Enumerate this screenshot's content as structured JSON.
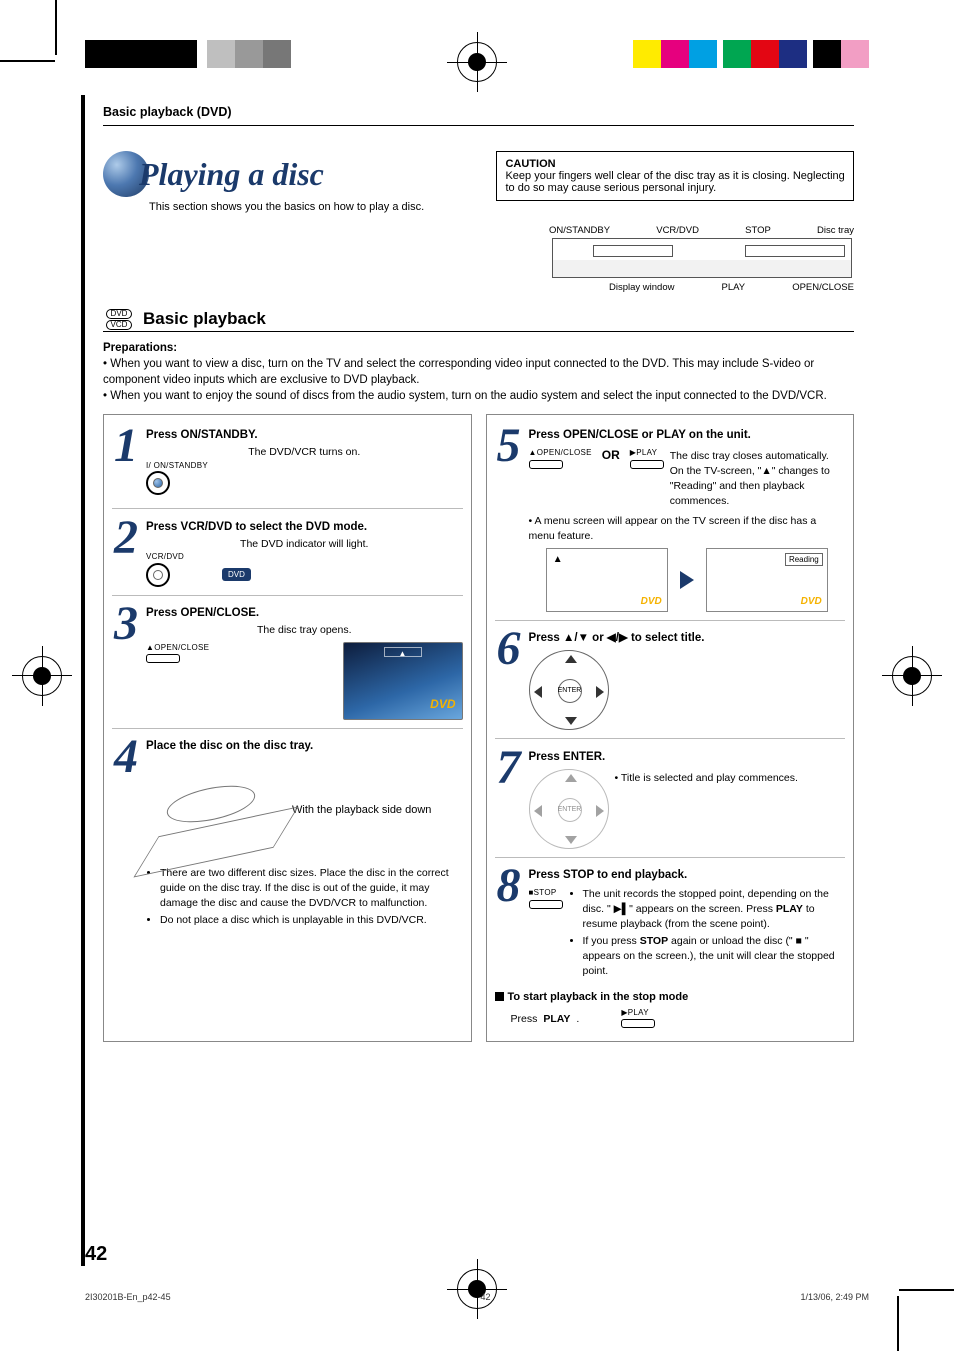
{
  "header": {
    "section": "Basic playback (DVD)"
  },
  "title": {
    "main": "Playing a disc",
    "sub": "This section shows you the basics on how to play a disc."
  },
  "caution": {
    "heading": "CAUTION",
    "text": "Keep your fingers well clear of the disc tray as it is closing. Neglecting to do so may cause serious personal injury."
  },
  "device_labels": {
    "top": {
      "a": "ON/STANDBY",
      "b": "VCR/DVD",
      "c": "STOP",
      "d": "Disc tray"
    },
    "bottom": {
      "a": "Display window",
      "b": "PLAY",
      "c": "OPEN/CLOSE"
    }
  },
  "section_heading": "Basic playback",
  "format_icons": {
    "dvd": "DVD",
    "vcd": "VCD"
  },
  "preparations": {
    "heading": "Preparations:",
    "items": [
      "When you want to view a disc, turn on the TV and select the corresponding video input connected to the DVD. This may include S-video or component video inputs which are exclusive to DVD playback.",
      "When you want to enjoy the sound of discs from the audio system, turn on the audio system and select the input connected to the DVD/VCR."
    ]
  },
  "steps": {
    "s1": {
      "title": "Press ON/STANDBY.",
      "text": "The DVD/VCR turns on.",
      "label": "I/ ON/STANDBY"
    },
    "s2": {
      "title": "Press VCR/DVD to select the DVD mode.",
      "text": "The DVD indicator will light.",
      "label": "VCR/DVD",
      "badge": "DVD"
    },
    "s3": {
      "title": "Press OPEN/CLOSE.",
      "text": "The disc tray opens.",
      "label": "OPEN/CLOSE"
    },
    "s4": {
      "title": "Place the disc on the disc tray.",
      "caption": "With the playback side down",
      "bullets": [
        "There are two different disc sizes. Place the disc in the correct guide on the disc tray. If the disc is out of the guide, it may damage the disc and cause the DVD/VCR to malfunction.",
        "Do not place a disc which is unplayable in this DVD/VCR."
      ]
    },
    "s5": {
      "title": "Press OPEN/CLOSE or PLAY on the unit.",
      "text": "The disc tray closes automatically. On the TV-screen, \"▲\" changes to \"Reading\" and then playback commences.",
      "label_open": "OPEN/CLOSE",
      "label_play": "PLAY",
      "or": "OR",
      "bullet": "A menu screen will appear on the TV screen if the disc has a menu feature.",
      "reading": "Reading"
    },
    "s6": {
      "title": "Press ▲/▼ or ◀/▶ to select title.",
      "enter": "ENTER"
    },
    "s7": {
      "title": "Press ENTER.",
      "bullet": "Title is selected and play commences.",
      "enter": "ENTER"
    },
    "s8": {
      "title": "Press STOP to end playback.",
      "label": "STOP",
      "bullets": [
        "The unit records the stopped point, depending on the disc. \" ▶▌\" appears on the screen. Press PLAY to resume playback (from the scene point).",
        "If you press STOP again or unload the disc (\" ■ \" appears on the screen.), the unit will clear the stopped point."
      ],
      "bold1": "PLAY",
      "bold2": "STOP"
    }
  },
  "restart": {
    "heading": "To start playback in the stop mode",
    "text_a": "Press ",
    "text_b": "PLAY",
    "label": "PLAY"
  },
  "page_number": "42",
  "footer": {
    "left": "2I30201B-En_p42-45",
    "mid": "42",
    "right": "1/13/06, 2:49 PM"
  },
  "dvd_logo": "DVD"
}
